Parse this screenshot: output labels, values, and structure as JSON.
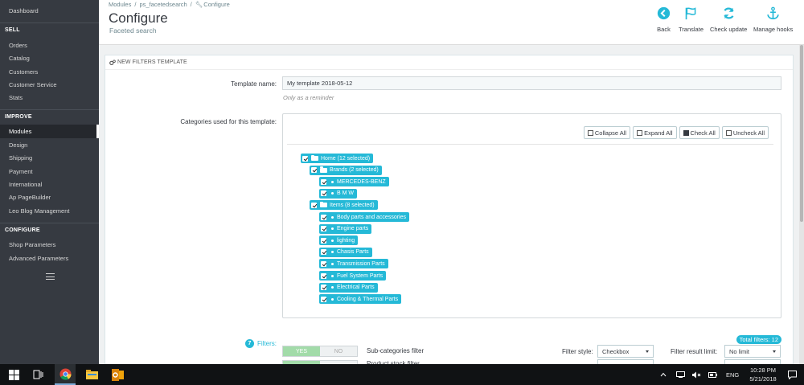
{
  "sidebar": {
    "top_item": "Dashboard",
    "sections": [
      {
        "heading": "SELL",
        "items": [
          "Orders",
          "Catalog",
          "Customers",
          "Customer Service",
          "Stats"
        ]
      },
      {
        "heading": "IMPROVE",
        "items": [
          "Modules",
          "Design",
          "Shipping",
          "Payment",
          "International",
          "Ap PageBuilder",
          "Leo Blog Management"
        ]
      },
      {
        "heading": "CONFIGURE",
        "items": [
          "Shop Parameters",
          "Advanced Parameters"
        ]
      }
    ],
    "active_item": "Modules"
  },
  "header": {
    "breadcrumb": [
      "Modules",
      "/",
      "ps_facetedsearch",
      "/",
      "Configure"
    ],
    "title": "Configure",
    "subtitle": "Faceted search",
    "toolbar": [
      {
        "label": "Back",
        "icon": "back-circle-icon"
      },
      {
        "label": "Translate",
        "icon": "flag-icon"
      },
      {
        "label": "Check update",
        "icon": "refresh-icon"
      },
      {
        "label": "Manage hooks",
        "icon": "anchor-icon"
      }
    ],
    "accent_color": "#25b9d7"
  },
  "panel": {
    "title": "NEW FILTERS TEMPLATE",
    "template_name_label": "Template name:",
    "template_name_value": "My template 2018-05-12",
    "template_name_help": "Only as a reminder",
    "categories_label": "Categories used for this template:",
    "tree_tools": [
      "Collapse All",
      "Expand All",
      "Check All",
      "Uncheck All"
    ],
    "tree": [
      {
        "label": "Home (12 selected)",
        "level": 0,
        "type": "folder"
      },
      {
        "label": "Brands (2 selected)",
        "level": 1,
        "type": "folder"
      },
      {
        "label": "MERCEDES-BENZ",
        "level": 2,
        "type": "leaf"
      },
      {
        "label": "B M W",
        "level": 2,
        "type": "leaf"
      },
      {
        "label": "Items (8 selected)",
        "level": 1,
        "type": "folder"
      },
      {
        "label": "Body parts and accessories",
        "level": 2,
        "type": "leaf"
      },
      {
        "label": "Engine parts",
        "level": 2,
        "type": "leaf"
      },
      {
        "label": "lighting",
        "level": 2,
        "type": "leaf"
      },
      {
        "label": "Chasis Parts",
        "level": 2,
        "type": "leaf"
      },
      {
        "label": "Transmission Parts",
        "level": 2,
        "type": "leaf"
      },
      {
        "label": "Fuel System Parts",
        "level": 2,
        "type": "leaf"
      },
      {
        "label": "Electrical Parts",
        "level": 2,
        "type": "leaf"
      },
      {
        "label": "Cooling & Thermal Parts",
        "level": 2,
        "type": "leaf"
      }
    ]
  },
  "filters": {
    "count": "7",
    "label": "Filters:",
    "total": "Total filters: 12",
    "yes": "YES",
    "no": "NO",
    "row1_name": "Sub-categories filter",
    "row2_name": "Product stock filter",
    "style_label": "Filter style:",
    "style_value": "Checkbox",
    "limit_label": "Filter result limit:",
    "limit_value": "No limit"
  },
  "taskbar": {
    "language": "ENG",
    "time": "10:28 PM",
    "date": "5/21/2018"
  }
}
